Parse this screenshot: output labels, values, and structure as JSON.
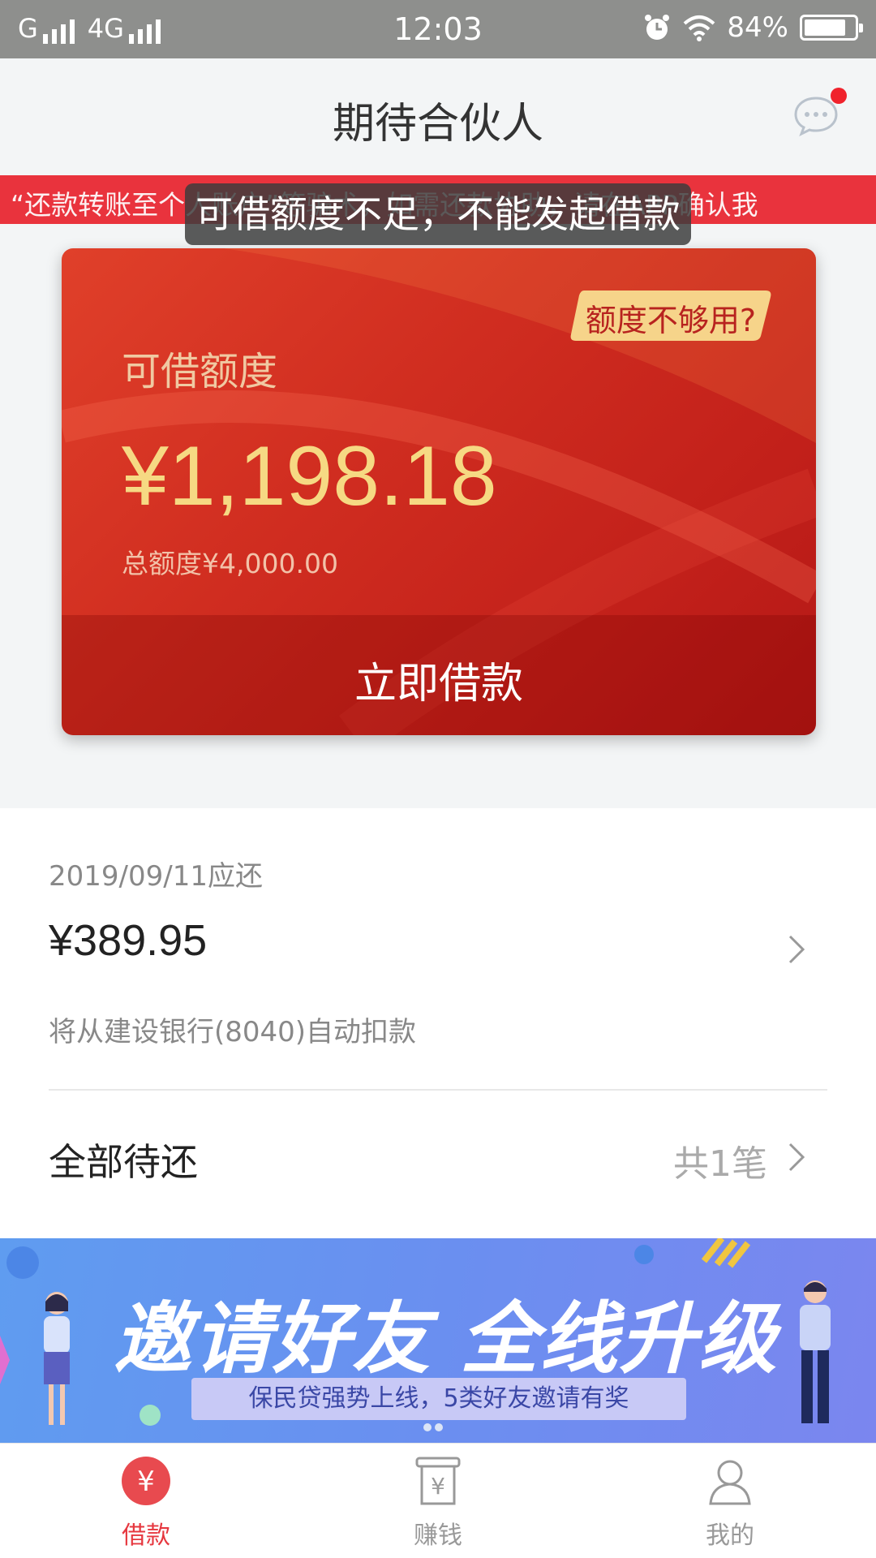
{
  "status_bar": {
    "carrier1": "G",
    "carrier2": "4G",
    "time": "12:03",
    "battery": "84%",
    "battery_level": 0.84,
    "icons": [
      "signal-icon",
      "alarm-icon",
      "wifi-icon",
      "battery-icon"
    ]
  },
  "header": {
    "title": "期待合伙人",
    "message_icon": "chat-bubble-icon",
    "has_unread": true
  },
  "notice": {
    "text": "、“还款转账至个人账户”等骗术，如需还款协助，请在APP确认我"
  },
  "toast": {
    "text": "可借额度不足，不能发起借款"
  },
  "credit_card": {
    "label": "可借额度",
    "amount": "¥1,198.18",
    "total": "总额度¥4,000.00",
    "limit_button": "额度不够用?",
    "borrow_button": "立即借款"
  },
  "repayment": {
    "due_date_label": "2019/09/11应还",
    "due_amount": "¥389.95",
    "debit_note": "将从建设银行(8040)自动扣款",
    "all_due_label": "全部待还",
    "all_due_count": "共1笔"
  },
  "banner": {
    "headline": "邀请好友 全线升级",
    "subline": "保民贷强势上线，5类好友邀请有奖",
    "pages": 2,
    "current_page": 1
  },
  "bottom_nav": {
    "items": [
      {
        "label": "借款",
        "icon": "yuan-circle-icon",
        "active": true
      },
      {
        "label": "赚钱",
        "icon": "yuan-receipt-icon",
        "active": false
      },
      {
        "label": "我的",
        "icon": "person-icon",
        "active": false
      }
    ]
  },
  "colors": {
    "accent": "#e6373f",
    "card_red": "#c2201a",
    "amount_gold": "#f6d983",
    "banner_blue": "#6a8ff0"
  }
}
